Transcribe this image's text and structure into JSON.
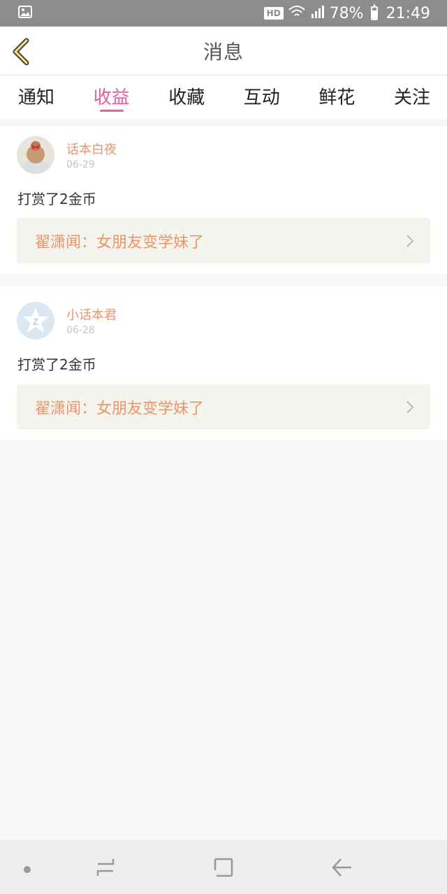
{
  "status_bar": {
    "hd_label": "HD",
    "battery_percent": "78%",
    "battery_level": 0.78,
    "time": "21:49"
  },
  "header": {
    "title": "消息"
  },
  "tabs": [
    {
      "label": "通知",
      "active": false
    },
    {
      "label": "收益",
      "active": true
    },
    {
      "label": "收藏",
      "active": false
    },
    {
      "label": "互动",
      "active": false
    },
    {
      "label": "鲜花",
      "active": false
    },
    {
      "label": "关注",
      "active": false
    }
  ],
  "messages": [
    {
      "user": "话本白夜",
      "date": "06-29",
      "text": "打赏了2金币",
      "book": "翟潇闻：女朋友变学妹了"
    },
    {
      "user": "小话本君",
      "date": "06-28",
      "text": "打赏了2金币",
      "book": "翟潇闻：女朋友变学妹了"
    }
  ],
  "colors": {
    "accent": "#e85e9c",
    "username": "#e8956b",
    "book_text": "#ee9366",
    "book_bg": "#f4f4ee"
  },
  "icons": {
    "back": "chevron-left-icon",
    "link_arrow": "chevron-right-icon",
    "nav": [
      "dot-icon",
      "recent-apps-icon",
      "home-icon",
      "back-arrow-icon"
    ]
  }
}
